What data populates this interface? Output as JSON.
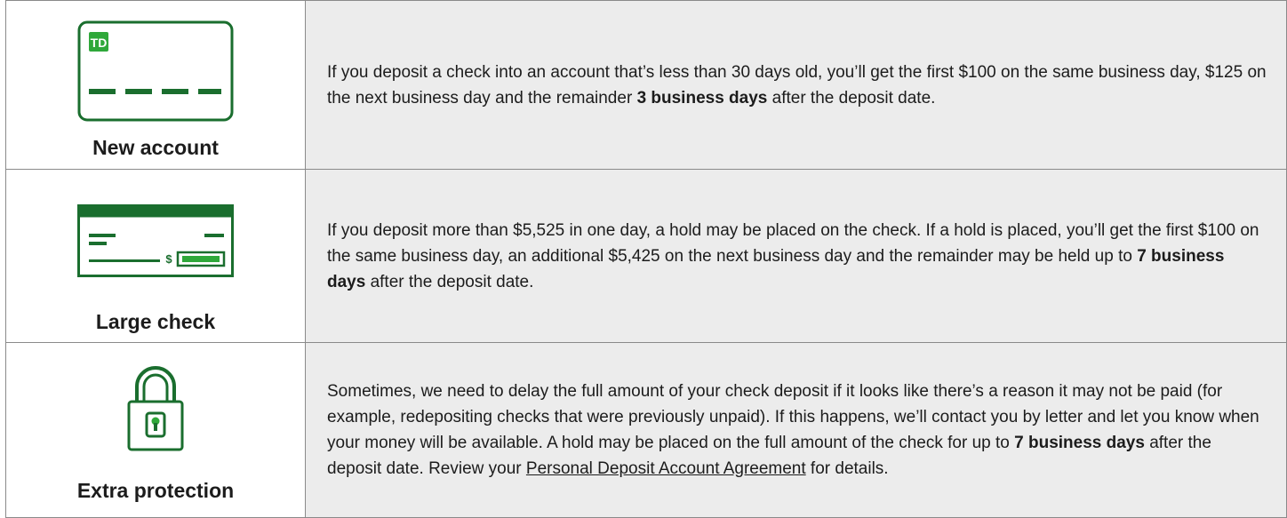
{
  "colors": {
    "brand_green": "#1a6e2e",
    "cell_bg": "#ececec",
    "border": "#8a8a8a"
  },
  "rows": [
    {
      "icon": "new-account-card-icon",
      "label": "New account",
      "text_before": "If you deposit a check into an account that’s less than 30 days old, you’ll get the first $100 on the same business day, $125 on the next business day and the remainder ",
      "emphasis": "3 business days",
      "text_after": " after the deposit date."
    },
    {
      "icon": "check-icon",
      "label": "Large check",
      "text_before": "If you deposit more than $5,525 in one day, a hold may be placed on the check. If a hold is placed, you’ll get the first $100 on the same business day, an additional $5,425 on the next business day and the remainder may be held up to ",
      "emphasis": "7 business days",
      "text_after": " after the deposit date."
    },
    {
      "icon": "padlock-icon",
      "label": "Extra protection",
      "text_before": "Sometimes, we need to delay the full amount of your check deposit if it looks like there’s a reason it may not be paid (for example, redepositing checks that were previously unpaid). If this happens, we’ll contact you by letter and let you know when your money will be available. A hold may be placed on the full amount of the check for up to ",
      "emphasis": "7 business days",
      "text_middle": " after the deposit date. Review your ",
      "link_text": "Personal Deposit Account Agreement",
      "text_after": " for details."
    }
  ],
  "card_logo_text": "TD",
  "check_symbol": "$"
}
